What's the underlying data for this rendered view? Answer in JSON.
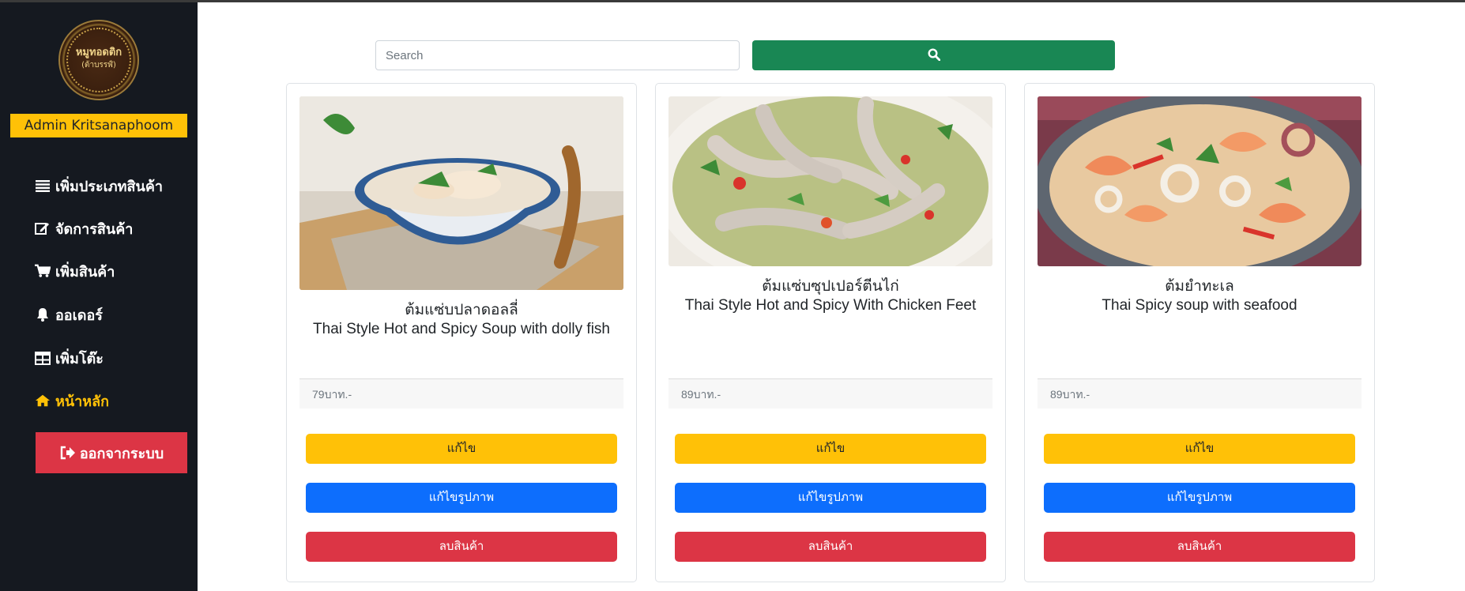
{
  "sidebar": {
    "logo_text": "หมูทอดติก",
    "logo_sub": "(ต้าบรรฬ์)",
    "admin_label": "Admin Kritsanaphoom",
    "items": [
      {
        "label": "เพิ่มประเภทสินค้า",
        "icon": "list-icon"
      },
      {
        "label": "จัดการสินค้า",
        "icon": "edit-icon"
      },
      {
        "label": "เพิ่มสินค้า",
        "icon": "cart-icon"
      },
      {
        "label": "ออเดอร์",
        "icon": "bell-icon"
      },
      {
        "label": "เพิ่มโต๊ะ",
        "icon": "table-icon"
      },
      {
        "label": "หน้าหลัก",
        "icon": "home-icon",
        "active": true
      }
    ],
    "logout_label": "ออกจากระบบ"
  },
  "search": {
    "placeholder": "Search",
    "value": ""
  },
  "colors": {
    "sidebar_bg": "#151920",
    "accent_yellow": "#ffc107",
    "search_green": "#198754",
    "edit_blue": "#0d6efd",
    "danger_red": "#dc3545"
  },
  "products": [
    {
      "name_th": "ต้มแซ่บปลาดอลลี่",
      "name_en": "Thai Style Hot and Spicy Soup with dolly fish",
      "price": "79บาท.-",
      "edit_label": "แก้ไข",
      "edit_image_label": "แก้ไขรูปภาพ",
      "delete_label": "ลบสินค้า"
    },
    {
      "name_th": "ต้มแซ่บซุปเปอร์ตีนไก่",
      "name_en": "Thai Style Hot and Spicy With Chicken Feet",
      "price": "89บาท.-",
      "edit_label": "แก้ไข",
      "edit_image_label": "แก้ไขรูปภาพ",
      "delete_label": "ลบสินค้า"
    },
    {
      "name_th": "ต้มยำทะเล",
      "name_en": "Thai Spicy soup with seafood",
      "price": "89บาท.-",
      "edit_label": "แก้ไข",
      "edit_image_label": "แก้ไขรูปภาพ",
      "delete_label": "ลบสินค้า"
    }
  ]
}
